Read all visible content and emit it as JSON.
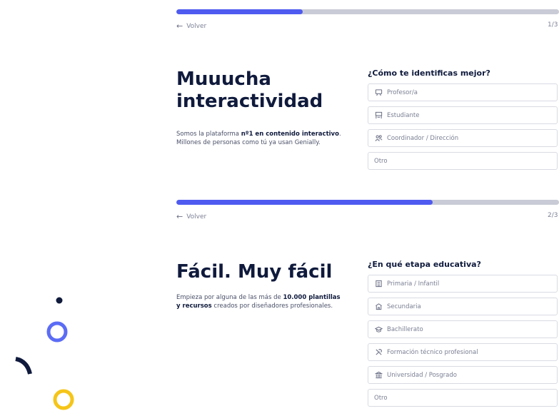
{
  "step1": {
    "progress": 0.33,
    "back_label": "Volver",
    "step_count": "1/3",
    "heading_line1": "Muuucha",
    "heading_line2": "interactividad",
    "desc_line1_a": "Somos la plataforma ",
    "desc_line1_b": "nº1 en contenido interactivo",
    "desc_line1_c": ".",
    "desc_line2": "Millones de personas como tú ya usan Genially.",
    "question": "¿Cómo te identificas mejor?",
    "options": [
      {
        "label": "Profesor/a",
        "icon": "presentation-board-icon"
      },
      {
        "label": "Estudiante",
        "icon": "student-desk-icon"
      },
      {
        "label": "Coordinador / Dirección",
        "icon": "people-icon"
      },
      {
        "label": "Otro",
        "icon": ""
      }
    ]
  },
  "step2": {
    "progress": 0.67,
    "back_label": "Volver",
    "step_count": "2/3",
    "heading": "Fácil. Muy fácil",
    "desc_line1_a": "Empieza por alguna de las más de ",
    "desc_line1_b": "10.000 plantillas",
    "desc_line2_a": "y recursos",
    "desc_line2_b": " creados por diseñadores profesionales.",
    "question": "¿En qué etapa educativa?",
    "options": [
      {
        "label": "Primaria / Infantil",
        "icon": "building-blocks-icon"
      },
      {
        "label": "Secundaria",
        "icon": "school-icon"
      },
      {
        "label": "Bachillerato",
        "icon": "graduation-cap-icon"
      },
      {
        "label": "Formación técnico profesional",
        "icon": "tools-icon"
      },
      {
        "label": "Universidad / Posgrado",
        "icon": "university-icon"
      },
      {
        "label": "Otro",
        "icon": ""
      }
    ]
  },
  "colors": {
    "accent": "#4f5bf0",
    "track": "#c9cbd6",
    "heading": "#0f1a3c",
    "deco_yellow": "#f5c518",
    "deco_blue": "#5b6cf5",
    "deco_dark": "#0f1a3c"
  }
}
